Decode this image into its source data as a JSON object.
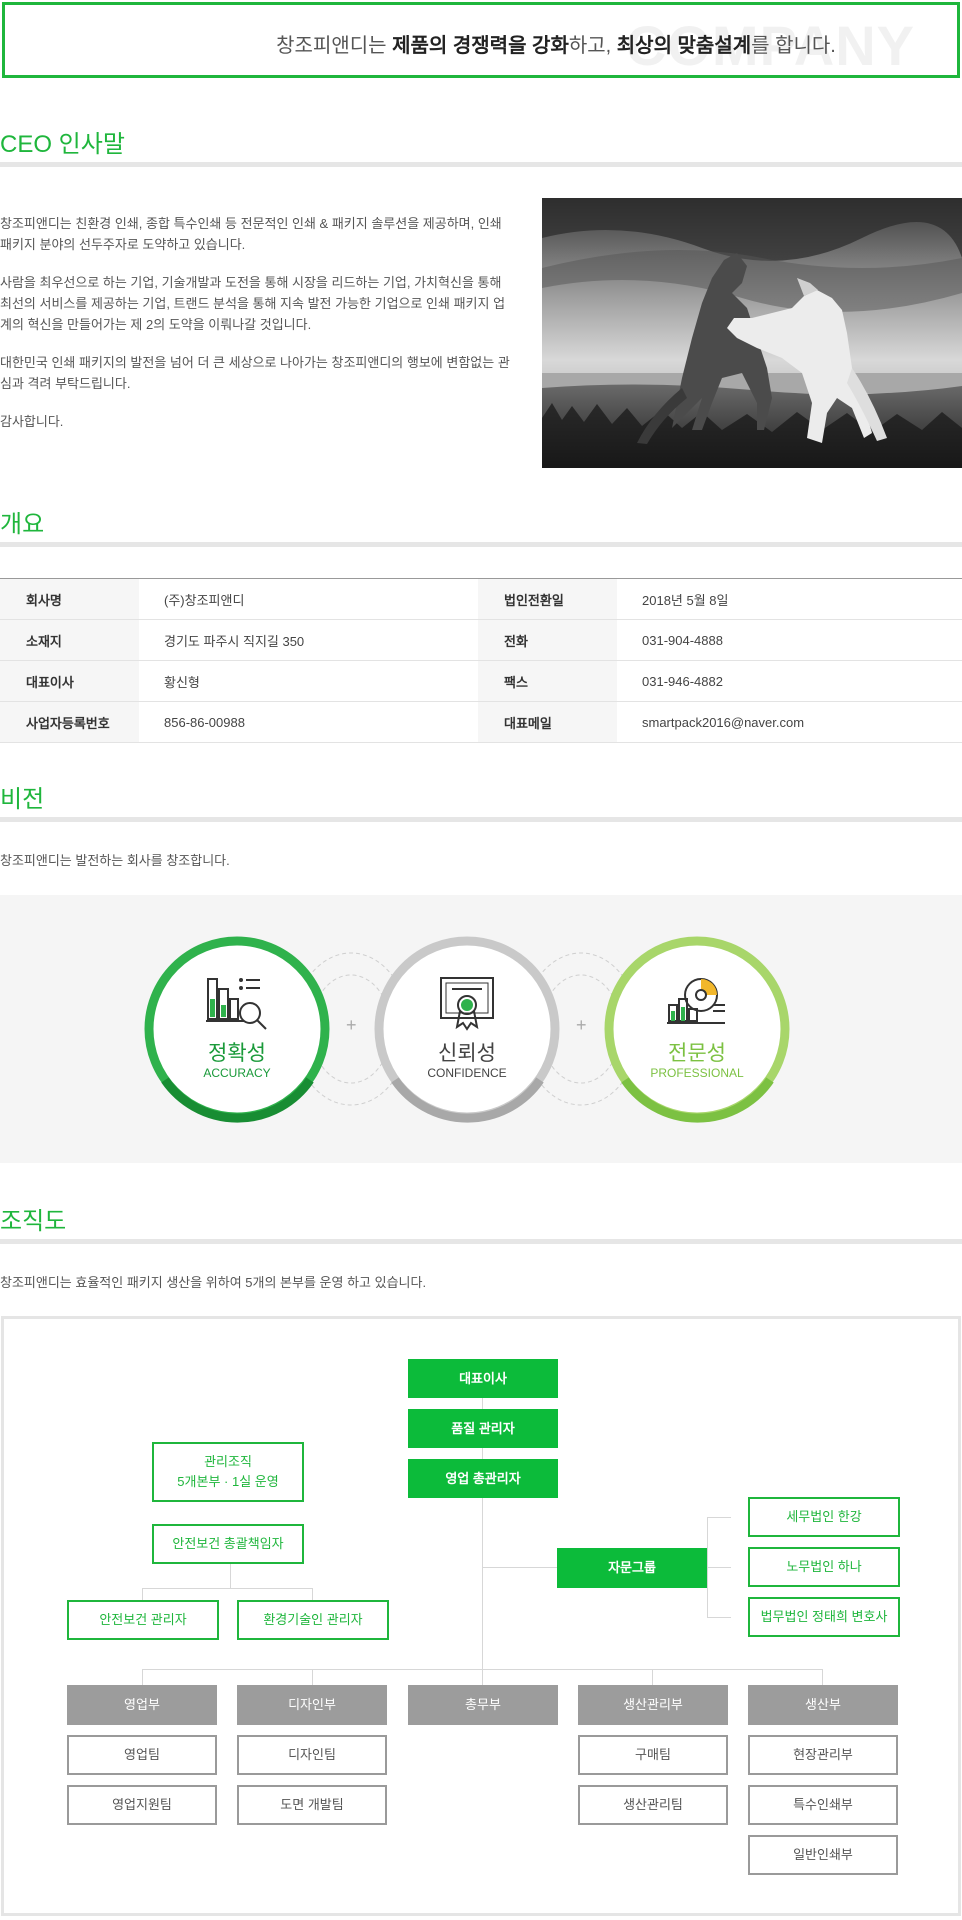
{
  "banner": {
    "watermark": "COMPANY",
    "text_1": "창조피앤디는 ",
    "bold_1": "제품의 경쟁력을 강화",
    "text_2": "하고, ",
    "bold_2": "최상의 맞춤설계",
    "text_3": "를 합니다."
  },
  "ceo": {
    "title": "CEO 인사말",
    "p1": "창조피앤디는 친환경 인쇄, 종합 특수인쇄 등 전문적인 인쇄 & 패키지 솔루션을 제공하며, 인쇄 패키지 분야의 선두주자로 도약하고 있습니다.",
    "p2": "사람을 최우선으로 하는 기업, 기술개발과 도전을 통해 시장을 리드하는 기업, 가치혁신을 통해 최선의 서비스를 제공하는 기업, 트랜드 분석을 통해 지속 발전 가능한 기업으로 인쇄 패키지 업계의 혁신을 만들어가는 제 2의 도약을 이뤄나갈 것입니다.",
    "p3": "대한민국 인쇄 패키지의 발전을 넘어 더 큰 세상으로 나아가는 창조피앤디의 행보에 변함없는 관심과 격려 부탁드립니다.",
    "p4": "감사합니다."
  },
  "overview": {
    "title": "개요",
    "rows": [
      {
        "k1": "회사명",
        "v1": "(주)창조피앤디",
        "k2": "법인전환일",
        "v2": "2018년 5월 8일"
      },
      {
        "k1": "소재지",
        "v1": "경기도 파주시 직지길 350",
        "k2": "전화",
        "v2": "031-904-4888"
      },
      {
        "k1": "대표이사",
        "v1": "황신형",
        "k2": "팩스",
        "v2": "031-946-4882"
      },
      {
        "k1": "사업자등록번호",
        "v1": "856-86-00988",
        "k2": "대표메일",
        "v2": "smartpack2016@naver.com"
      }
    ]
  },
  "vision": {
    "title": "비전",
    "desc": "창조피앤디는 발전하는 회사를 창조합니다.",
    "items": [
      {
        "ko": "정확성",
        "en": "ACCURACY",
        "icon": "chart-magnifier-icon",
        "color": "#1a9a3a"
      },
      {
        "ko": "신뢰성",
        "en": "CONFIDENCE",
        "icon": "certificate-icon",
        "color": "#444444"
      },
      {
        "ko": "전문성",
        "en": "PROFESSIONAL",
        "icon": "pie-chart-icon",
        "color": "#7cc142"
      }
    ],
    "plus": "+"
  },
  "org": {
    "title": "조직도",
    "desc": "창조피앤디는 효율적인 패키지 생산을 위하여 5개의 본부를 운영 하고 있습니다.",
    "ceo": "대표이사",
    "quality": "품질 관리자",
    "sales_manager": "영업 총관리자",
    "mgmt_line1": "관리조직",
    "mgmt_line2": "5개본부 · 1실 운영",
    "safety_chief": "안전보건 총괄책임자",
    "safety_manager": "안전보건 관리자",
    "env_manager": "환경기술인 관리자",
    "advisory": "자문그룹",
    "tax": "세무법인 한강",
    "labor": "노무법인 하나",
    "law": "법무법인 정태희 변호사",
    "departments": [
      {
        "name": "영업부",
        "teams": [
          "영업팀",
          "영업지원팀"
        ]
      },
      {
        "name": "디자인부",
        "teams": [
          "디자인팀",
          "도면 개발팀"
        ]
      },
      {
        "name": "총무부",
        "teams": []
      },
      {
        "name": "생산관리부",
        "teams": [
          "구매팀",
          "생산관리팀"
        ]
      },
      {
        "name": "생산부",
        "teams": [
          "현장관리부",
          "특수인쇄부",
          "일반인쇄부"
        ]
      }
    ]
  },
  "colors": {
    "accent": "#1fb63c",
    "gray": "#9c9c9c"
  }
}
